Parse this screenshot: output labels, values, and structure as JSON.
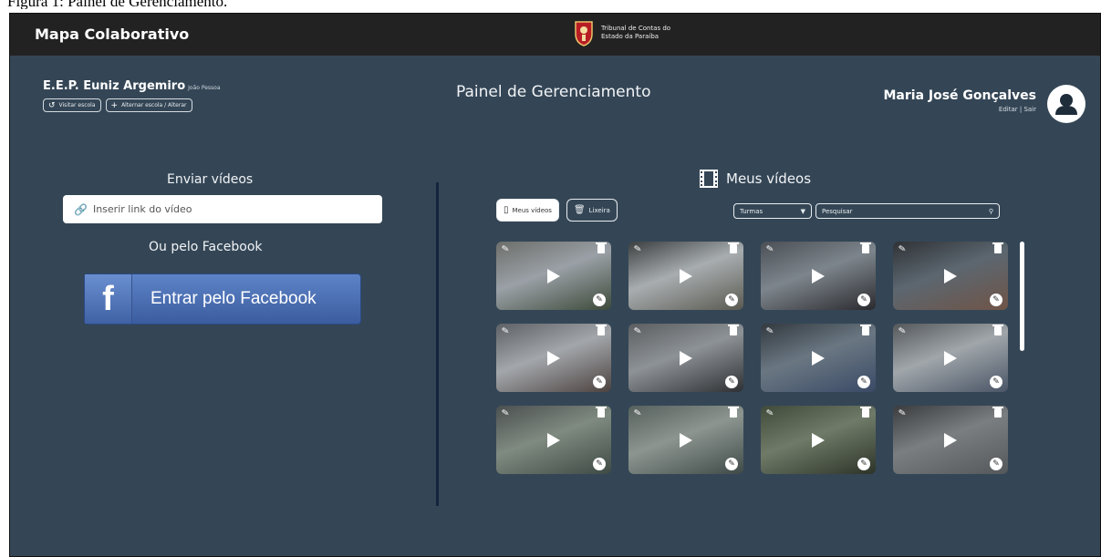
{
  "caption": "Figura 1: Painel de Gerenciamento.",
  "topbar": {
    "brand": "Mapa Colaborativo",
    "logo_text": "Tribunal de Contas do Estado da Paraíba"
  },
  "school": {
    "name": "E.E.P. Euniz Argemiro",
    "city": "João Pessoa",
    "buttons": [
      {
        "label": "Visitar escola",
        "icon": "refresh-icon"
      },
      {
        "label": "Alternar escola / Alterar",
        "icon": "plus-icon"
      }
    ]
  },
  "page_title": "Painel de Gerenciamento",
  "user": {
    "name": "Maria José Gonçalves",
    "links": "Editar | Sair"
  },
  "upload": {
    "title": "Enviar vídeos",
    "placeholder": "Inserir link do vídeo",
    "or_text": "Ou pelo Facebook",
    "facebook_button": "Entrar pelo Facebook"
  },
  "videos": {
    "heading": "Meus vídeos",
    "tabs": [
      {
        "label": "Meus vídeos",
        "active": true
      },
      {
        "label": "Lixeira",
        "active": false
      }
    ],
    "filter_select": "Turmas",
    "search_placeholder": "Pesquisar",
    "thumbnails": [
      {
        "colors": [
          "#6c6e6a",
          "#9aa0a6",
          "#3d4a3a"
        ]
      },
      {
        "colors": [
          "#3b3f40",
          "#a8adb0",
          "#5a5a50"
        ]
      },
      {
        "colors": [
          "#4a4f55",
          "#7d858c",
          "#2a2a2e"
        ]
      },
      {
        "colors": [
          "#2f3236",
          "#5c6770",
          "#6f5447"
        ]
      },
      {
        "colors": [
          "#5d6166",
          "#a3a7ab",
          "#4c4240"
        ]
      },
      {
        "colors": [
          "#5a5e60",
          "#8d9296",
          "#2e3033"
        ]
      },
      {
        "colors": [
          "#33393f",
          "#6a7782",
          "#3a4a66"
        ]
      },
      {
        "colors": [
          "#54585b",
          "#a0a6aa",
          "#4a5566"
        ]
      },
      {
        "colors": [
          "#4b5050",
          "#7f8a80",
          "#3e4a44"
        ]
      },
      {
        "colors": [
          "#56605c",
          "#8c9590",
          "#3f4a48"
        ]
      },
      {
        "colors": [
          "#3f4a3a",
          "#6f7a68",
          "#2c3428"
        ]
      },
      {
        "colors": [
          "#3a3c3e",
          "#7a7e80",
          "#55585a"
        ]
      }
    ]
  }
}
